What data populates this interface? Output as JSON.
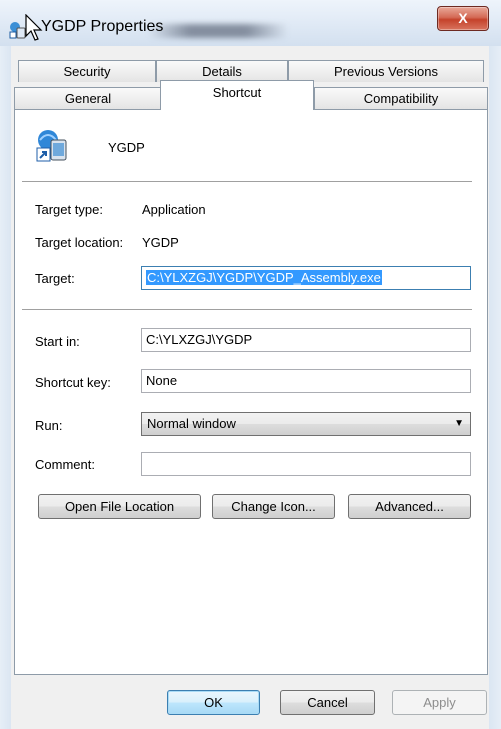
{
  "window": {
    "title": "YGDP Properties",
    "close_glyph": "X"
  },
  "tabs_row1": [
    {
      "label": "Security"
    },
    {
      "label": "Details"
    },
    {
      "label": "Previous Versions"
    }
  ],
  "tabs_row2": [
    {
      "label": "General"
    },
    {
      "label": "Shortcut",
      "active": true
    },
    {
      "label": "Compatibility"
    }
  ],
  "shortcut": {
    "name": "YGDP",
    "icon": "shortcut-app-icon",
    "target_type_label": "Target type:",
    "target_type_value": "Application",
    "target_location_label": "Target location:",
    "target_location_value": "YGDP",
    "target_label": "Target:",
    "target_value": "C:\\YLXZGJ\\YGDP\\YGDP_Assembly.exe",
    "start_in_label": "Start in:",
    "start_in_value": "C:\\YLXZGJ\\YGDP",
    "shortcut_key_label": "Shortcut key:",
    "shortcut_key_value": "None",
    "run_label": "Run:",
    "run_value": "Normal window",
    "comment_label": "Comment:",
    "comment_value": ""
  },
  "buttons": {
    "open_file_location": "Open File Location",
    "change_icon": "Change Icon...",
    "advanced": "Advanced...",
    "ok": "OK",
    "cancel": "Cancel",
    "apply": "Apply"
  },
  "colors": {
    "selection": "#3399ff",
    "close_button": "#c5422b"
  }
}
